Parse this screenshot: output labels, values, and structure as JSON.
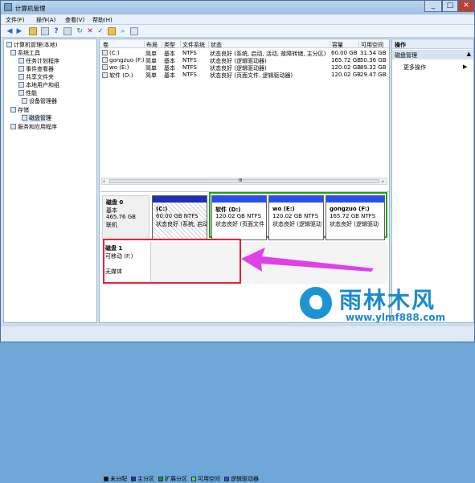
{
  "window": {
    "title": "计算机管理",
    "min": "_",
    "max": "□",
    "close": "✕"
  },
  "menu": [
    "文件(F)",
    "操作(A)",
    "查看(V)",
    "帮助(H)"
  ],
  "tree": {
    "root": "计算机管理(本地)",
    "system_tools": "系统工具",
    "task_scheduler": "任务计划程序",
    "event_viewer": "事件查看器",
    "shared_folders": "共享文件夹",
    "local_users": "本地用户和组",
    "performance": "性能",
    "device_manager": "设备管理器",
    "storage": "存储",
    "disk_management": "磁盘管理",
    "services": "服务和应用程序"
  },
  "columns": [
    "卷",
    "布局",
    "类型",
    "文件系统",
    "状态",
    "容量",
    "可用空间"
  ],
  "volumes": [
    {
      "vol": "(C:)",
      "layout": "简单",
      "type": "基本",
      "fs": "NTFS",
      "status": "状态良好 (系统, 启动, 活动, 故障转储, 主分区)",
      "cap": "60.00 GB",
      "free": "31.54 GB"
    },
    {
      "vol": "gongzuo (F:)",
      "layout": "简单",
      "type": "基本",
      "fs": "NTFS",
      "status": "状态良好 (逻辑驱动器)",
      "cap": "165.72 GB",
      "free": "50.36 GB"
    },
    {
      "vol": "wo (E:)",
      "layout": "简单",
      "type": "基本",
      "fs": "NTFS",
      "status": "状态良好 (逻辑驱动器)",
      "cap": "120.02 GB",
      "free": "89.32 GB"
    },
    {
      "vol": "软件 (D:)",
      "layout": "简单",
      "type": "基本",
      "fs": "NTFS",
      "status": "状态良好 (页面文件, 逻辑驱动器)",
      "cap": "120.02 GB",
      "free": "29.47 GB"
    }
  ],
  "scroll_mid": "III",
  "disk0": {
    "name": "磁盘 0",
    "type": "基本",
    "size": "465.76 GB",
    "state": "联机",
    "parts": [
      {
        "title": "(C:)",
        "size": "60.00 GB NTFS",
        "status": "状态良好 (系统, 启动"
      },
      {
        "title": "软件 (D:)",
        "size": "120.02 GB NTFS",
        "status": "状态良好 (页面文件"
      },
      {
        "title": "wo (E:)",
        "size": "120.02 GB NTFS",
        "status": "状态良好 (逻辑驱动"
      },
      {
        "title": "gongzuo (F:)",
        "size": "165.72 GB NTFS",
        "status": "状态良好 (逻辑驱动"
      }
    ]
  },
  "disk1": {
    "name": "磁盘 1",
    "type": "可移动 (F:)",
    "media": "无媒体"
  },
  "legend": [
    {
      "label": "未分配",
      "color": "#111111"
    },
    {
      "label": "主分区",
      "color": "#1f2fb4"
    },
    {
      "label": "扩展分区",
      "color": "#1aa31a"
    },
    {
      "label": "可用空间",
      "color": "#6ad66a"
    },
    {
      "label": "逻辑驱动器",
      "color": "#2a4ff0"
    }
  ],
  "actions": {
    "header": "操作",
    "section": "磁盘管理",
    "more": "更多操作"
  },
  "watermark": {
    "brand": "雨林木风",
    "url": "www.ylmf888.com"
  }
}
